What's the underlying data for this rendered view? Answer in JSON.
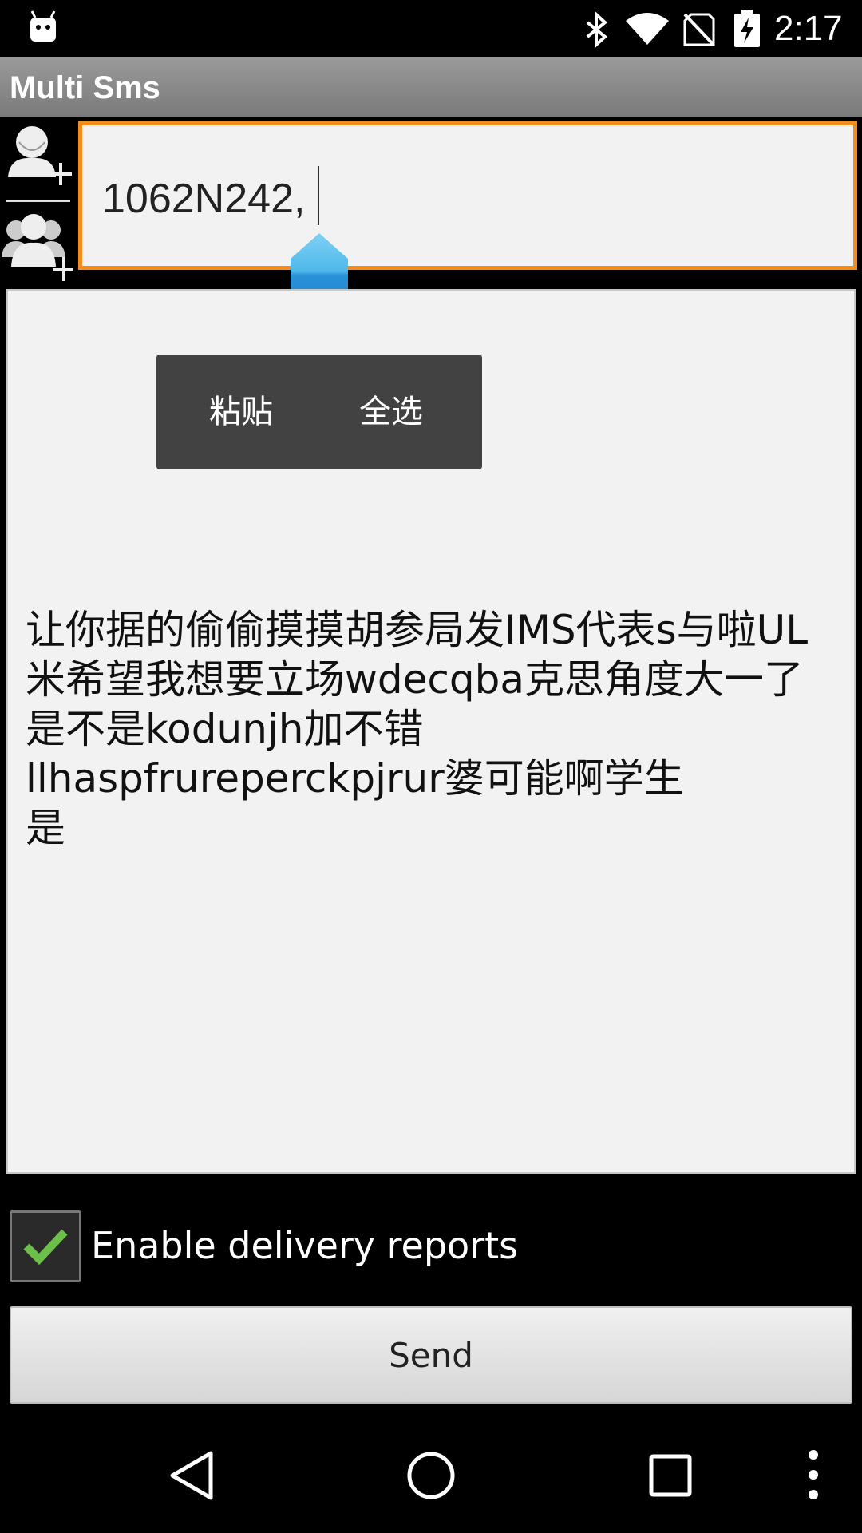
{
  "status_bar": {
    "time": "2:17",
    "icons": [
      "android-icon",
      "bluetooth-icon",
      "wifi-icon",
      "no-sim-icon",
      "battery-charging-icon"
    ]
  },
  "app": {
    "title": "Multi Sms"
  },
  "recipients": {
    "value": "1062N242,"
  },
  "context_menu": {
    "paste_label": "粘贴",
    "select_all_label": "全选"
  },
  "message": {
    "text": "让你据的偷偷摸摸胡参局发IMS代表s与啦UL米希望我想要立场wdecqba克思角度大一了是不是kodunjh加不错\nllhaspfrureperckpjrur婆可能啊学生\n是"
  },
  "options": {
    "delivery_reports_label": "Enable delivery reports",
    "delivery_reports_checked": true
  },
  "actions": {
    "send_label": "Send"
  },
  "colors": {
    "focus_border": "#f28c1a",
    "handle": "#2f9fe0",
    "check": "#6cc04a"
  }
}
